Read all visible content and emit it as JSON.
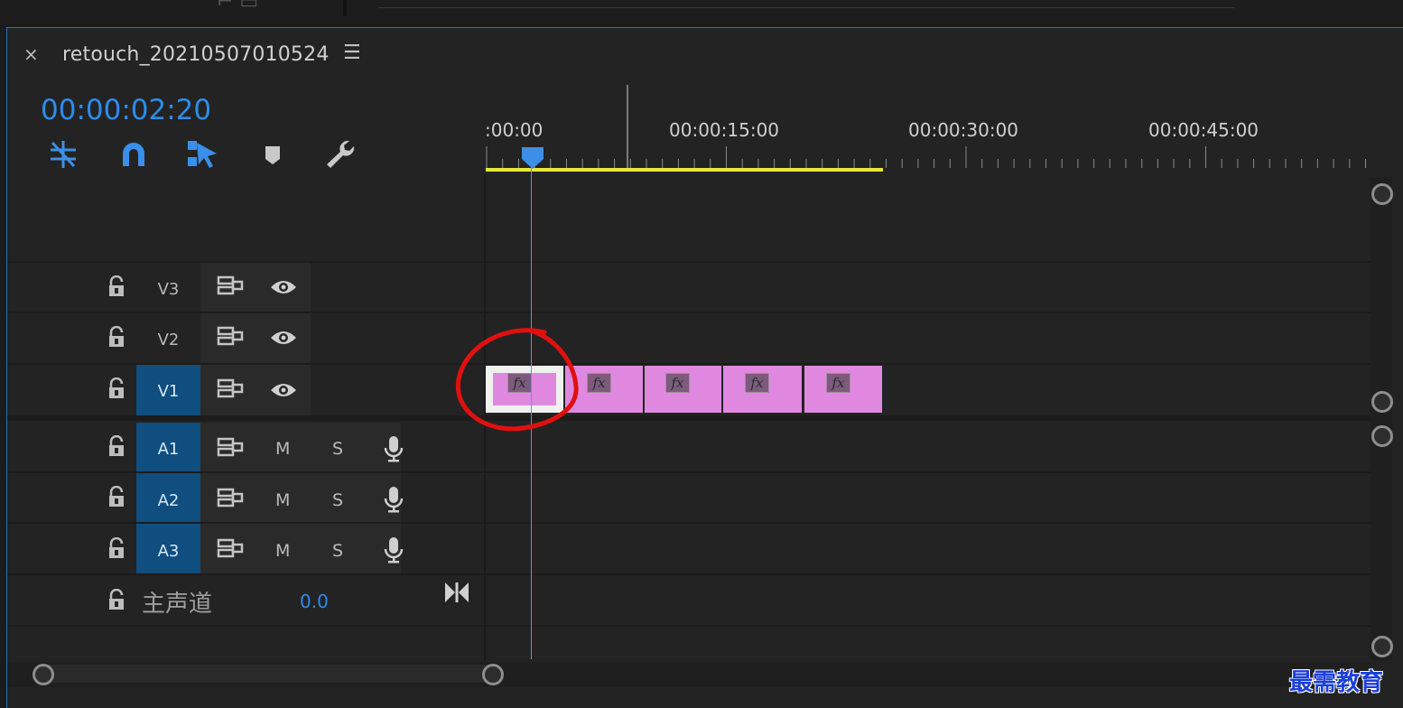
{
  "panel": {
    "close_glyph": "×",
    "sequence_title": "retouch_20210507010524",
    "menu_glyph": "☰",
    "timecode": "00:00:02:20"
  },
  "toolbar": {
    "tools": [
      {
        "name": "insert-nest-icon"
      },
      {
        "name": "snap-magnet-icon"
      },
      {
        "name": "linked-selection-icon"
      },
      {
        "name": "add-marker-icon"
      },
      {
        "name": "wrench-settings-icon"
      }
    ]
  },
  "ruler": {
    "labels": [
      ":00:00",
      "00:00:15:00",
      "00:00:30:00",
      "00:00:45:00"
    ]
  },
  "video_tracks": [
    {
      "name": "V3",
      "targeted": false
    },
    {
      "name": "V2",
      "targeted": false
    },
    {
      "name": "V1",
      "targeted": true
    }
  ],
  "audio_tracks": [
    {
      "name": "A1",
      "mute": "M",
      "solo": "S"
    },
    {
      "name": "A2",
      "mute": "M",
      "solo": "S"
    },
    {
      "name": "A3",
      "mute": "M",
      "solo": "S"
    }
  ],
  "master": {
    "label": "主声道",
    "volume": "0.0"
  },
  "clips": [
    {
      "fx": "fx",
      "selected": true
    },
    {
      "fx": "fx",
      "selected": false
    },
    {
      "fx": "fx",
      "selected": false
    },
    {
      "fx": "fx",
      "selected": false
    },
    {
      "fx": "fx",
      "selected": false
    }
  ],
  "watermark": "最需教育",
  "colors": {
    "accent_blue": "#2d8ceb",
    "target_track": "#0f4e7e",
    "clip_pink": "#e088e0",
    "work_area_yellow": "#e6e63c",
    "annotation_red": "#e01010"
  }
}
